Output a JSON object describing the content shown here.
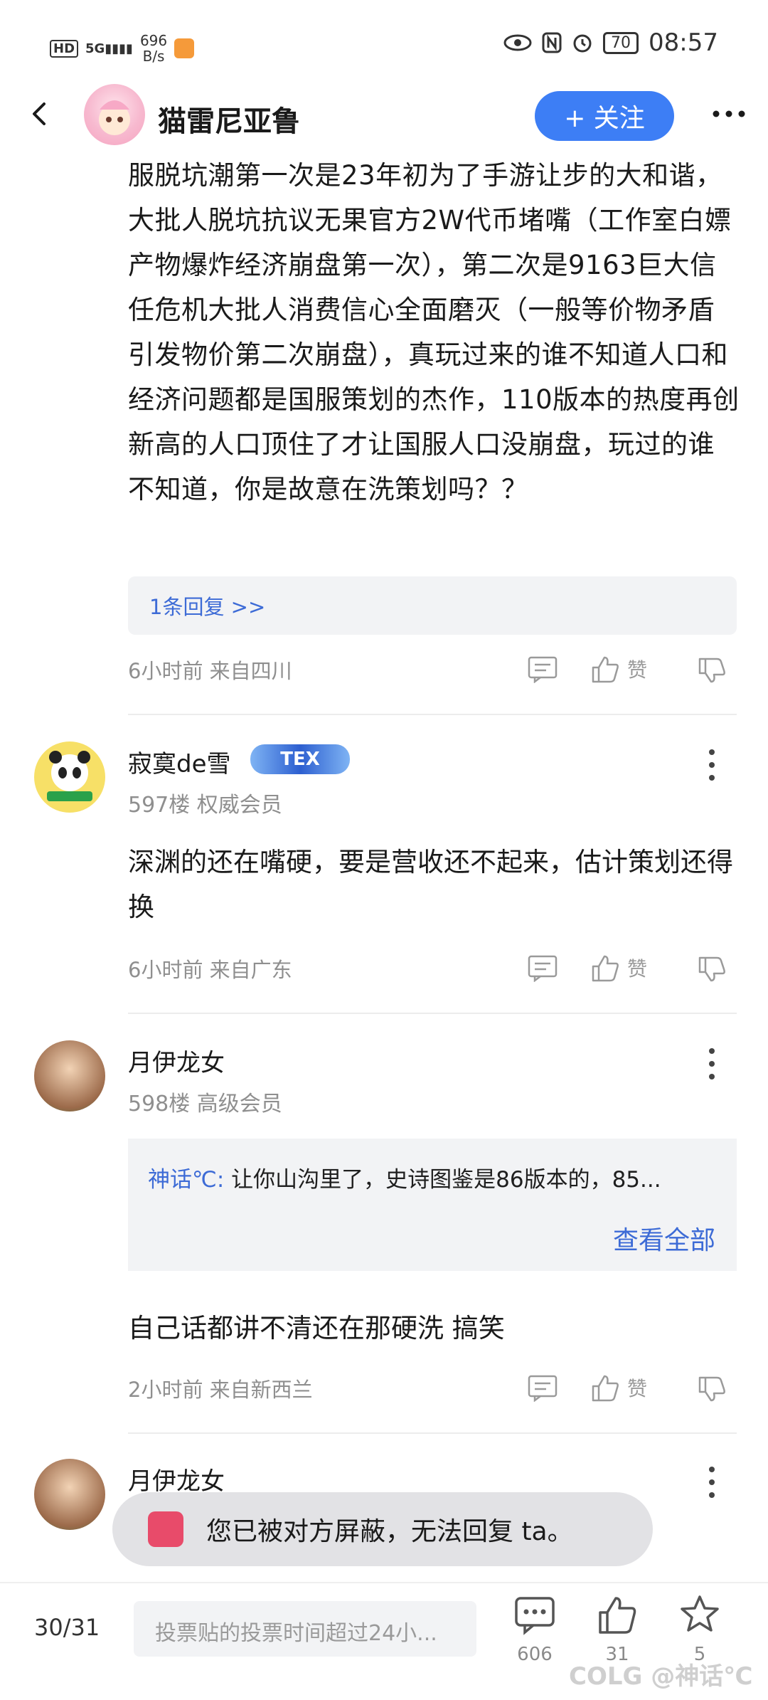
{
  "status_bar": {
    "network": "HD",
    "signal": "5G",
    "speed": "696",
    "speed_unit": "B/s",
    "battery": "70",
    "time": "08:57"
  },
  "header": {
    "author": "猫雷尼亚鲁",
    "follow_label": "+ 关注"
  },
  "post": {
    "text": "服脱坑潮第一次是23年初为了手游让步的大和谐，大批人脱坑抗议无果官方2W代币堵嘴（工作室白嫖产物爆炸经济崩盘第一次），第二次是9163巨大信任危机大批人消费信心全面磨灭（一般等价物矛盾引发物价第二次崩盘），真玩过来的谁不知道人口和经济问题都是国服策划的杰作，110版本的热度再创新高的人口顶住了才让国服人口没崩盘，玩过的谁不知道，你是故意在洗策划吗？？",
    "replies_label": "1条回复 >>",
    "meta": "6小时前 来自四川",
    "like_label": "赞"
  },
  "comments": [
    {
      "name": "寂寞de雪",
      "badge": "TEX",
      "floor": "597楼 权威会员",
      "text": "深渊的还在嘴硬，要是营收还不起来，估计策划还得换",
      "meta": "6小时前 来自广东",
      "like_label": "赞"
    },
    {
      "name": "月伊龙女",
      "floor": "598楼 高级会员",
      "quote_name": "神话℃:",
      "quote_text": " 让你山沟里了，史诗图鉴是86版本的，85...",
      "quote_more": "查看全部",
      "text": "自己话都讲不清还在那硬洗 搞笑",
      "meta": "2小时前 来自新西兰",
      "like_label": "赞"
    },
    {
      "name": "月伊龙女"
    }
  ],
  "toast": {
    "text": "您已被对方屏蔽，无法回复 ta。"
  },
  "bottom_bar": {
    "page": "30/31",
    "input_placeholder": "投票贴的投票时间超过24小...",
    "comment_count": "606",
    "like_count": "31",
    "fav_count": "5",
    "watermark": "COLG @神话℃"
  }
}
